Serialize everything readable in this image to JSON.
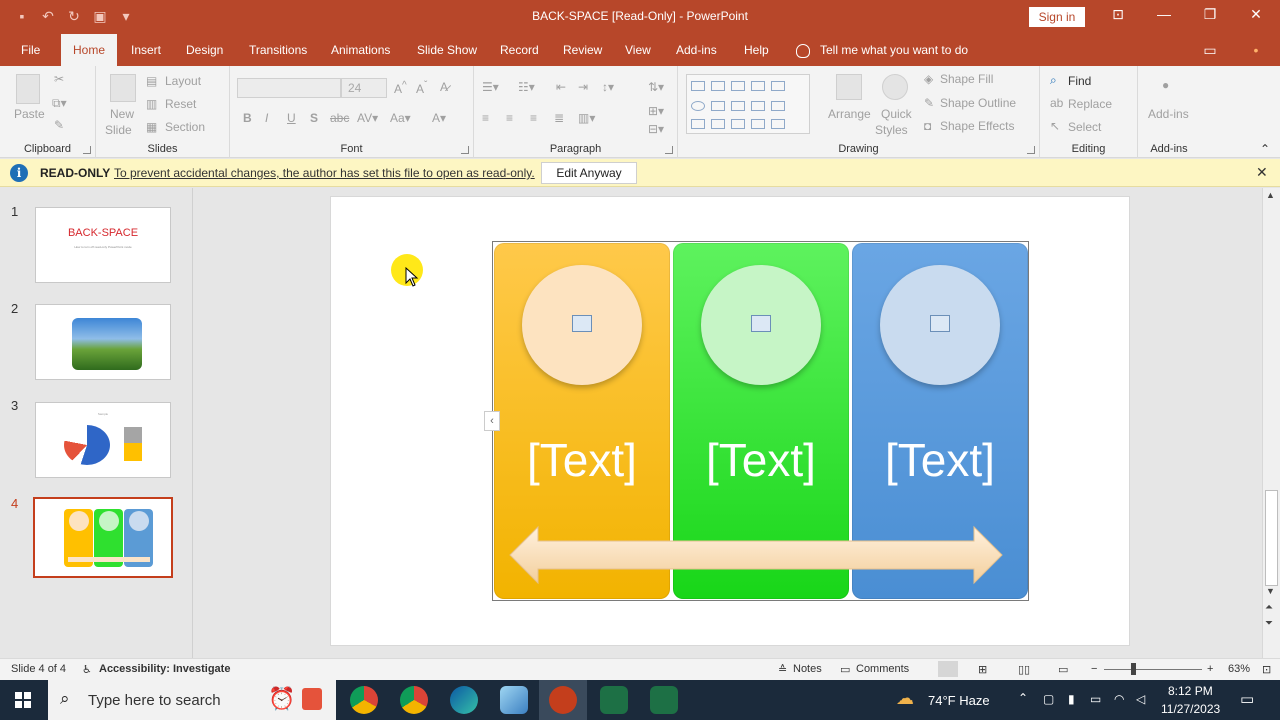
{
  "titlebar": {
    "title": "BACK-SPACE [Read-Only]  -  PowerPoint",
    "sign_in": "Sign in"
  },
  "tabs": [
    "File",
    "Home",
    "Insert",
    "Design",
    "Transitions",
    "Animations",
    "Slide Show",
    "Record",
    "Review",
    "View",
    "Add-ins",
    "Help"
  ],
  "active_tab": "Home",
  "tell_me": "Tell me what you want to do",
  "ribbon": {
    "clipboard": {
      "paste": "Paste",
      "label": "Clipboard"
    },
    "slides": {
      "new_slide": "New",
      "new_slide2": "Slide",
      "layout": "Layout",
      "reset": "Reset",
      "section": "Section",
      "label": "Slides"
    },
    "font": {
      "size": "24",
      "label": "Font"
    },
    "paragraph": {
      "label": "Paragraph"
    },
    "drawing": {
      "arrange": "Arrange",
      "quick": "Quick",
      "styles": "Styles",
      "shape_fill": "Shape Fill",
      "shape_outline": "Shape Outline",
      "shape_effects": "Shape Effects",
      "label": "Drawing"
    },
    "editing": {
      "find": "Find",
      "replace": "Replace",
      "select": "Select",
      "label": "Editing"
    },
    "addins": {
      "button": "Add-ins",
      "label": "Add-ins"
    }
  },
  "infobar": {
    "title": "READ-ONLY",
    "message": "To prevent accidental changes, the author has set this file to open as read-only.",
    "button": "Edit Anyway"
  },
  "thumbnails": [
    {
      "num": "1",
      "title": "BACK-SPACE",
      "subtitle": "How to turn off read-only PowerPoint mode"
    },
    {
      "num": "2"
    },
    {
      "num": "3",
      "caption": "Sample"
    },
    {
      "num": "4"
    }
  ],
  "slide": {
    "columns": [
      {
        "text": "[Text]",
        "color_top": "#ffc94a",
        "color_bottom": "#f2b300",
        "circle": "#fde3c0"
      },
      {
        "text": "[Text]",
        "color_top": "#5ef25e",
        "color_bottom": "#18d618",
        "circle": "#c6f5c6"
      },
      {
        "text": "[Text]",
        "color_top": "#6aa6e4",
        "color_bottom": "#4a8ed3",
        "circle": "#c9dbef"
      }
    ]
  },
  "status": {
    "slide_info": "Slide 4 of 4",
    "accessibility": "Accessibility: Investigate",
    "notes": "Notes",
    "comments": "Comments",
    "zoom": "63%"
  },
  "taskbar": {
    "search": "Type here to search",
    "weather": "74°F  Haze",
    "time": "8:12 PM",
    "date": "11/27/2023"
  }
}
